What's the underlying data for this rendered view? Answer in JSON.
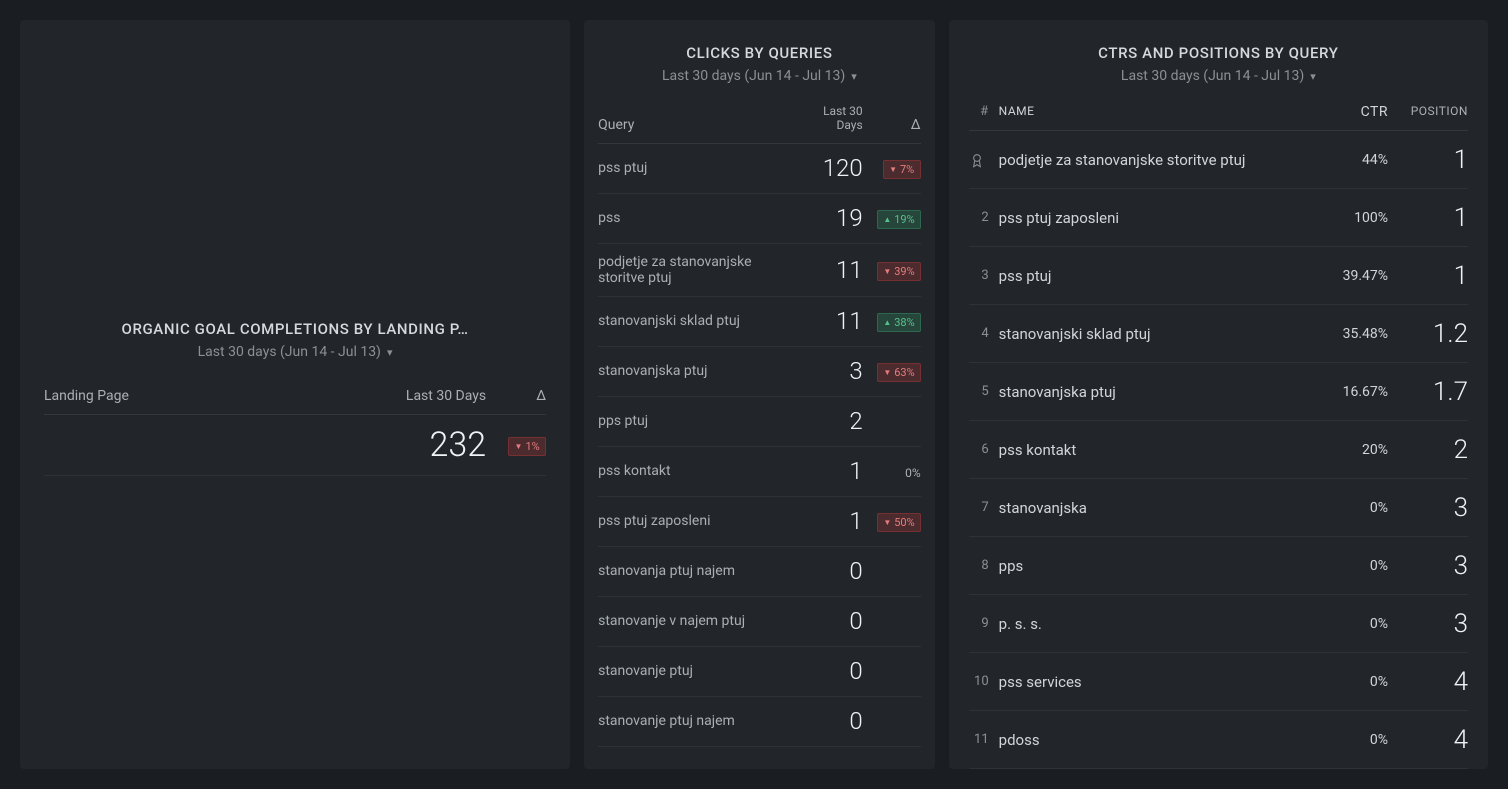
{
  "dateRange": "Last 30 days (Jun 14 - Jul 13)",
  "leftPanel": {
    "title": "ORGANIC GOAL COMPLETIONS BY LANDING P…",
    "headers": {
      "c1": "Landing Page",
      "c2": "Last 30 Days",
      "c3": "Δ"
    },
    "rows": [
      {
        "page": "",
        "value": "232",
        "delta": "1%",
        "dir": "down"
      }
    ]
  },
  "midPanel": {
    "title": "CLICKS BY QUERIES",
    "headers": {
      "c1": "Query",
      "c2a": "Last 30",
      "c2b": "Days",
      "c3": "Δ"
    },
    "rows": [
      {
        "q": "pss ptuj",
        "v": "120",
        "delta": "7%",
        "dir": "down"
      },
      {
        "q": "pss",
        "v": "19",
        "delta": "19%",
        "dir": "up"
      },
      {
        "q": "podjetje za stanovanjske storitve ptuj",
        "v": "11",
        "delta": "39%",
        "dir": "down"
      },
      {
        "q": "stanovanjski sklad ptuj",
        "v": "11",
        "delta": "38%",
        "dir": "up"
      },
      {
        "q": "stanovanjska ptuj",
        "v": "3",
        "delta": "63%",
        "dir": "down"
      },
      {
        "q": "pps ptuj",
        "v": "2",
        "delta": "",
        "dir": ""
      },
      {
        "q": "pss kontakt",
        "v": "1",
        "delta": "0%",
        "dir": "flat"
      },
      {
        "q": "pss ptuj zaposleni",
        "v": "1",
        "delta": "50%",
        "dir": "down"
      },
      {
        "q": "stanovanja ptuj najem",
        "v": "0",
        "delta": "",
        "dir": ""
      },
      {
        "q": "stanovanje v najem ptuj",
        "v": "0",
        "delta": "",
        "dir": ""
      },
      {
        "q": "stanovanje ptuj",
        "v": "0",
        "delta": "",
        "dir": ""
      },
      {
        "q": "stanovanje ptuj najem",
        "v": "0",
        "delta": "",
        "dir": ""
      }
    ]
  },
  "rightPanel": {
    "title": "CTRS AND POSITIONS BY QUERY",
    "headers": {
      "num": "#",
      "name": "NAME",
      "ctr": "CTR",
      "pos": "POSITION"
    },
    "rows": [
      {
        "n": "award",
        "name": "podjetje za stanovanjske storitve ptuj",
        "ctr": "44%",
        "pos": "1"
      },
      {
        "n": "2",
        "name": "pss ptuj zaposleni",
        "ctr": "100%",
        "pos": "1"
      },
      {
        "n": "3",
        "name": "pss ptuj",
        "ctr": "39.47%",
        "pos": "1"
      },
      {
        "n": "4",
        "name": "stanovanjski sklad ptuj",
        "ctr": "35.48%",
        "pos": "1.2"
      },
      {
        "n": "5",
        "name": "stanovanjska ptuj",
        "ctr": "16.67%",
        "pos": "1.7"
      },
      {
        "n": "6",
        "name": "pss kontakt",
        "ctr": "20%",
        "pos": "2"
      },
      {
        "n": "7",
        "name": "stanovanjska",
        "ctr": "0%",
        "pos": "3"
      },
      {
        "n": "8",
        "name": "pps",
        "ctr": "0%",
        "pos": "3"
      },
      {
        "n": "9",
        "name": "p. s. s.",
        "ctr": "0%",
        "pos": "3"
      },
      {
        "n": "10",
        "name": "pss services",
        "ctr": "0%",
        "pos": "4"
      },
      {
        "n": "11",
        "name": "pdoss",
        "ctr": "0%",
        "pos": "4"
      }
    ]
  }
}
